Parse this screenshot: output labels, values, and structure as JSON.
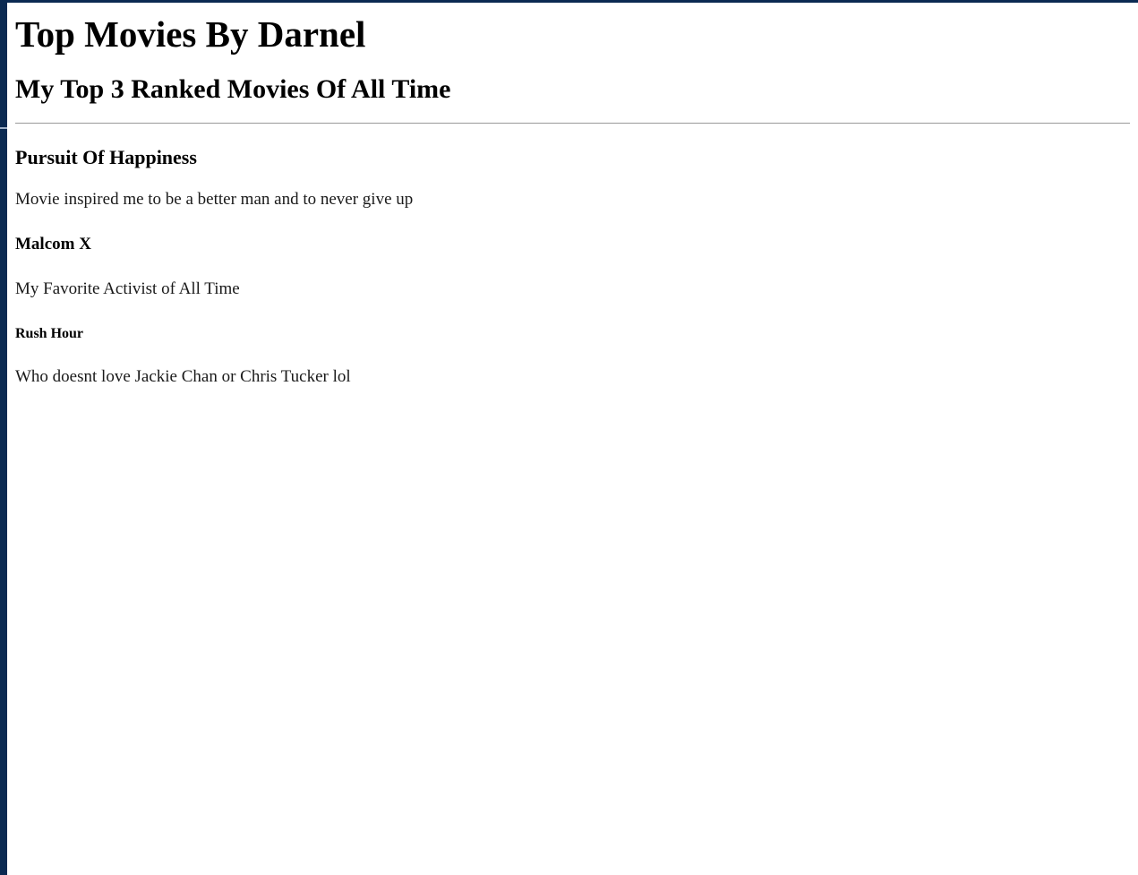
{
  "page": {
    "title": "Top Movies By Darnel",
    "subtitle": "My Top 3 Ranked Movies Of All Time"
  },
  "movies": [
    {
      "title": "Pursuit Of Happiness",
      "description": "Movie inspired me to be a better man and to never give up"
    },
    {
      "title": "Malcom X",
      "description": "My Favorite Activist of All Time"
    },
    {
      "title": "Rush Hour",
      "description": "Who doesnt love Jackie Chan or Chris Tucker lol"
    }
  ],
  "colors": {
    "frame": "#0b2a52",
    "rule": "#999999",
    "text": "#000000"
  }
}
